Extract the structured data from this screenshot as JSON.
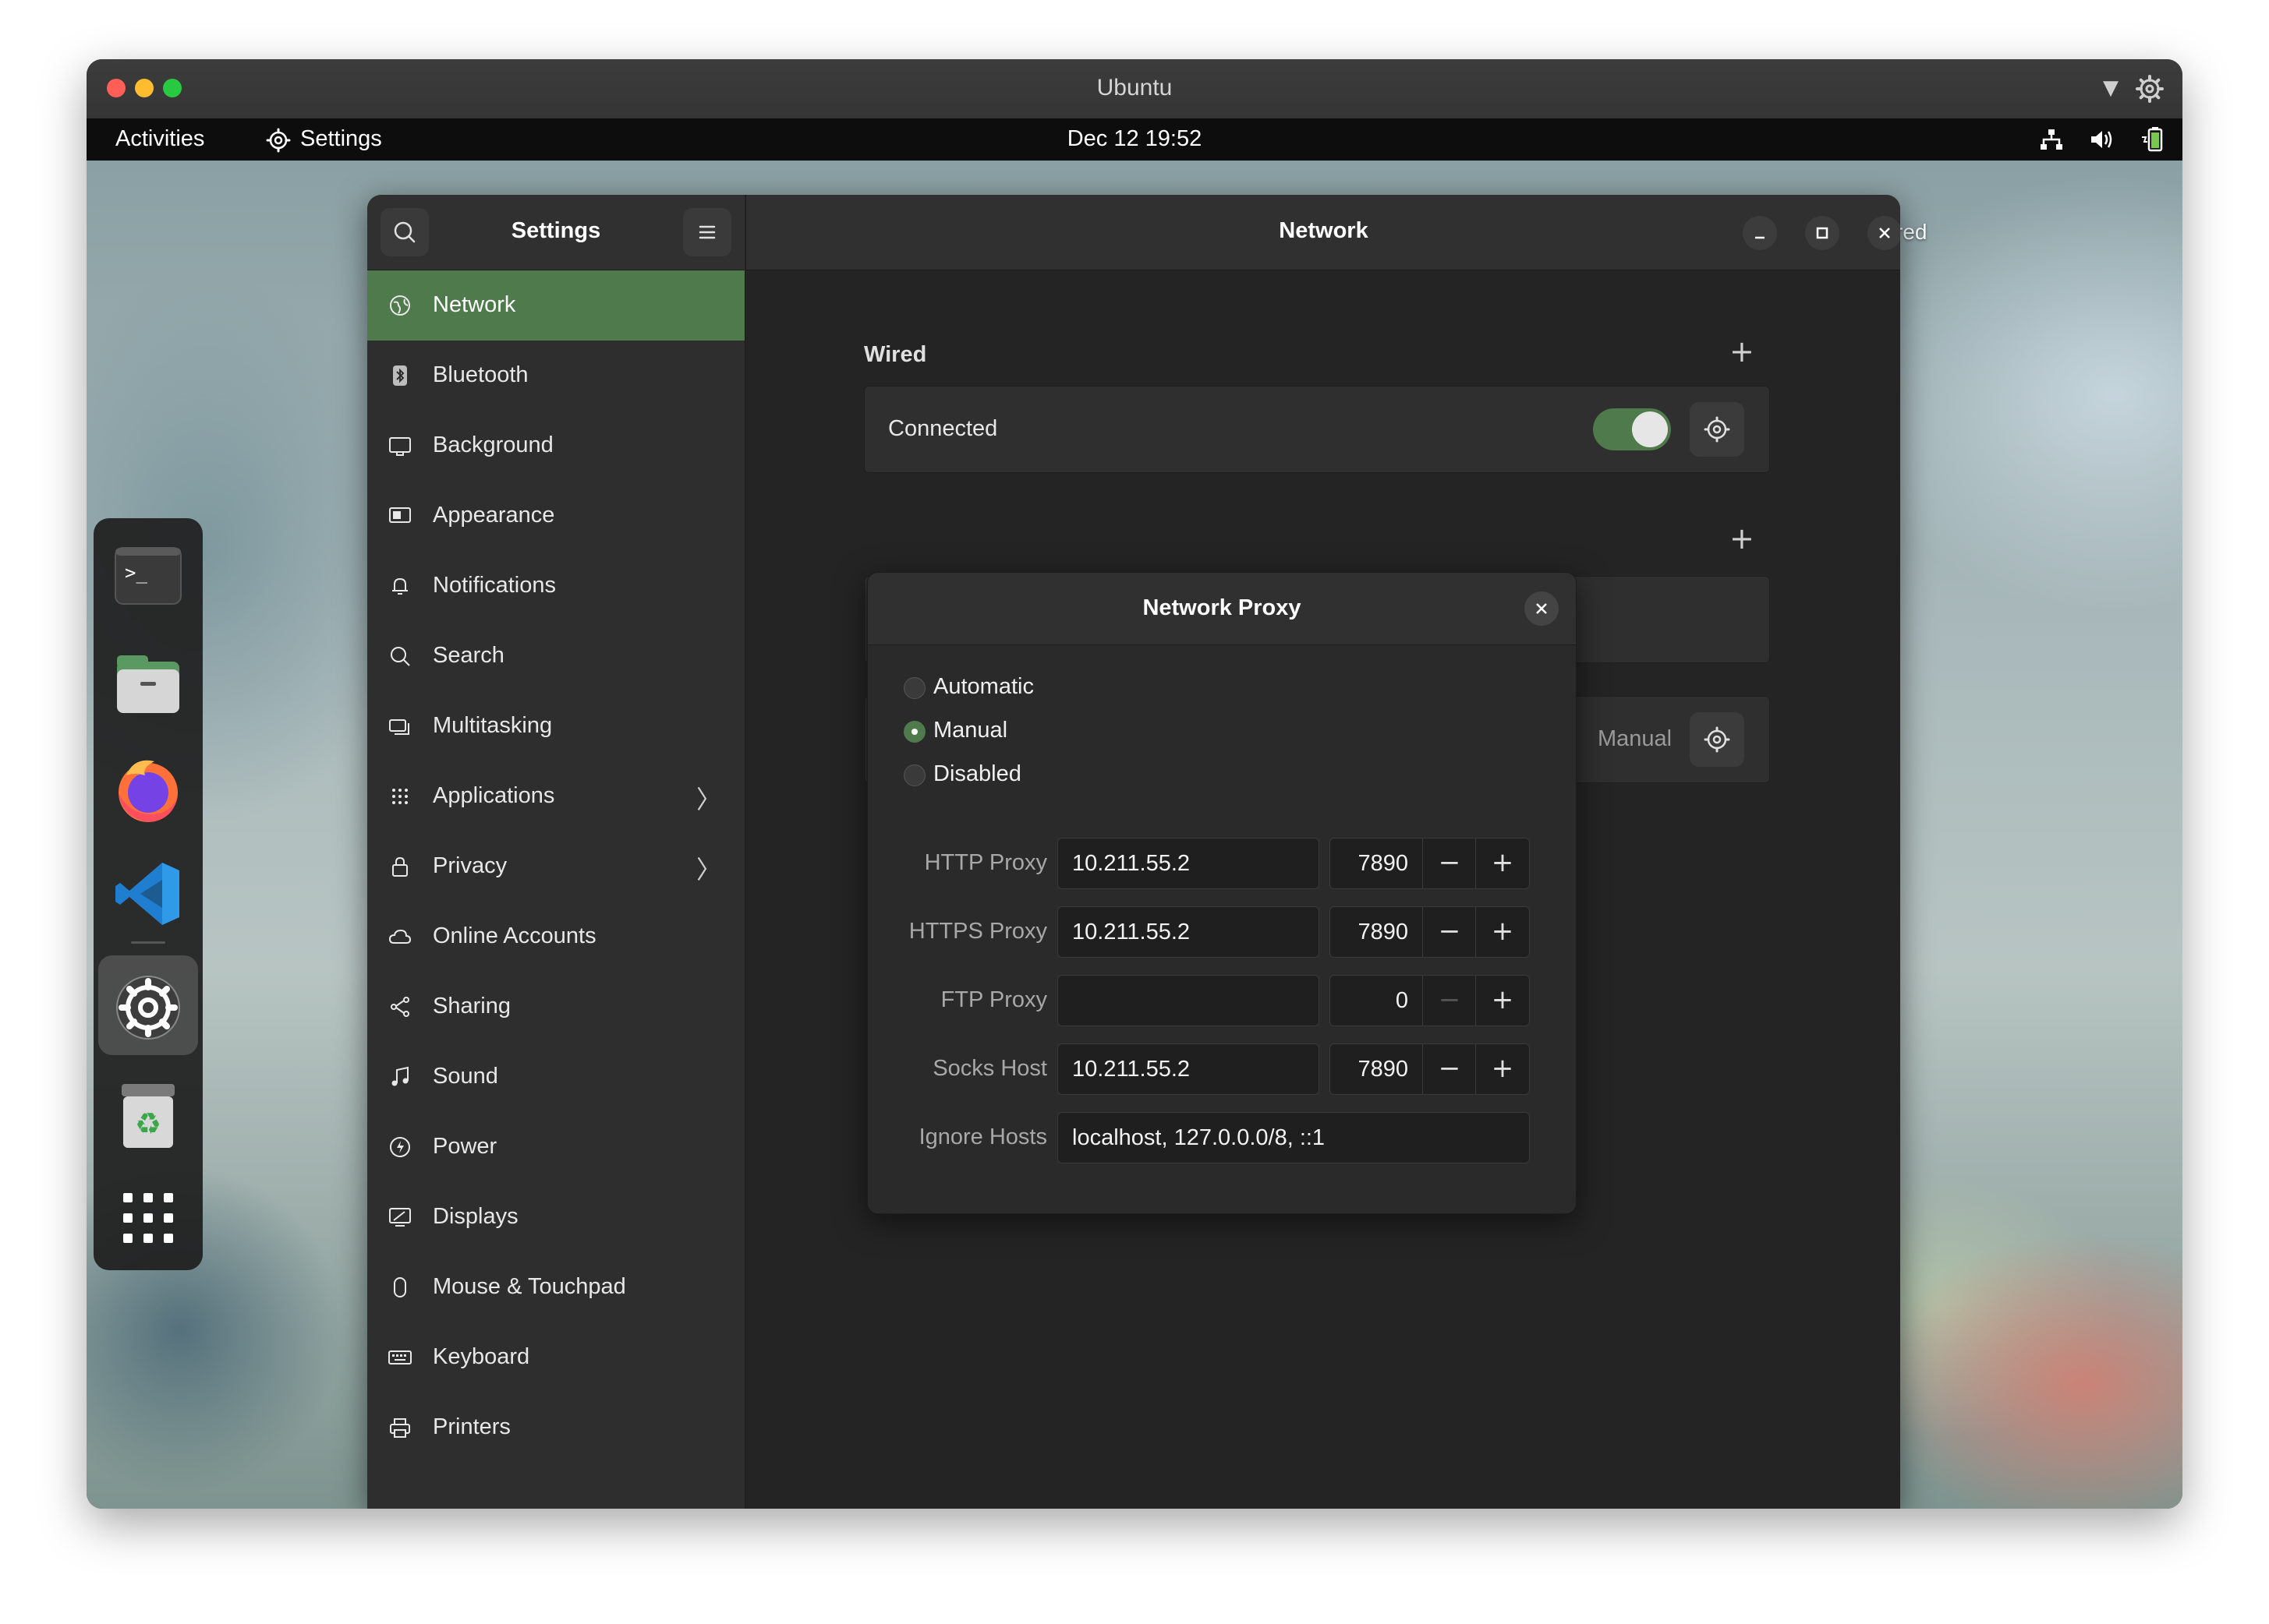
{
  "vm": {
    "title": "Ubuntu"
  },
  "topbar": {
    "activities": "Activities",
    "app_name": "Settings",
    "clock": "Dec 12  19:52"
  },
  "desktop": {
    "label_fragment": "red"
  },
  "dock": {
    "items": [
      {
        "name": "Terminal",
        "icon": "terminal-icon"
      },
      {
        "name": "Files",
        "icon": "files-icon"
      },
      {
        "name": "Firefox",
        "icon": "firefox-icon"
      },
      {
        "name": "Visual Studio Code",
        "icon": "vscode-icon"
      },
      {
        "name": "Settings",
        "icon": "settings-icon",
        "active": true
      },
      {
        "name": "Trash",
        "icon": "trash-icon"
      },
      {
        "name": "Show Applications",
        "icon": "app-grid-icon"
      }
    ]
  },
  "settings": {
    "sidebar_title": "Settings",
    "page_title": "Network",
    "nav": [
      {
        "label": "Network",
        "icon": "network-icon",
        "active": true
      },
      {
        "label": "Bluetooth",
        "icon": "bluetooth-icon"
      },
      {
        "label": "Background",
        "icon": "background-icon"
      },
      {
        "label": "Appearance",
        "icon": "appearance-icon"
      },
      {
        "label": "Notifications",
        "icon": "bell-icon"
      },
      {
        "label": "Search",
        "icon": "search-icon"
      },
      {
        "label": "Multitasking",
        "icon": "multitasking-icon"
      },
      {
        "label": "Applications",
        "icon": "apps-grid-icon",
        "chevron": true
      },
      {
        "label": "Privacy",
        "icon": "lock-icon",
        "chevron": true
      },
      {
        "label": "Online Accounts",
        "icon": "cloud-icon"
      },
      {
        "label": "Sharing",
        "icon": "share-icon"
      },
      {
        "label": "Sound",
        "icon": "music-note-icon"
      },
      {
        "label": "Power",
        "icon": "power-icon"
      },
      {
        "label": "Displays",
        "icon": "display-icon"
      },
      {
        "label": "Mouse & Touchpad",
        "icon": "mouse-icon"
      },
      {
        "label": "Keyboard",
        "icon": "keyboard-icon"
      },
      {
        "label": "Printers",
        "icon": "printer-icon"
      }
    ],
    "wired": {
      "title": "Wired",
      "status": "Connected",
      "enabled": true
    },
    "proxy_row": {
      "value": "Manual"
    }
  },
  "proxy_dialog": {
    "title": "Network Proxy",
    "modes": [
      {
        "label": "Automatic",
        "checked": false
      },
      {
        "label": "Manual",
        "checked": true
      },
      {
        "label": "Disabled",
        "checked": false
      }
    ],
    "rows": [
      {
        "label": "HTTP Proxy",
        "host": "10.211.55.2",
        "port": "7890"
      },
      {
        "label": "HTTPS Proxy",
        "host": "10.211.55.2",
        "port": "7890"
      },
      {
        "label": "FTP Proxy",
        "host": "",
        "port": "0"
      },
      {
        "label": "Socks Host",
        "host": "10.211.55.2",
        "port": "7890"
      }
    ],
    "ignore_hosts": {
      "label": "Ignore Hosts",
      "value": "localhost, 127.0.0.0/8, ::1"
    }
  }
}
